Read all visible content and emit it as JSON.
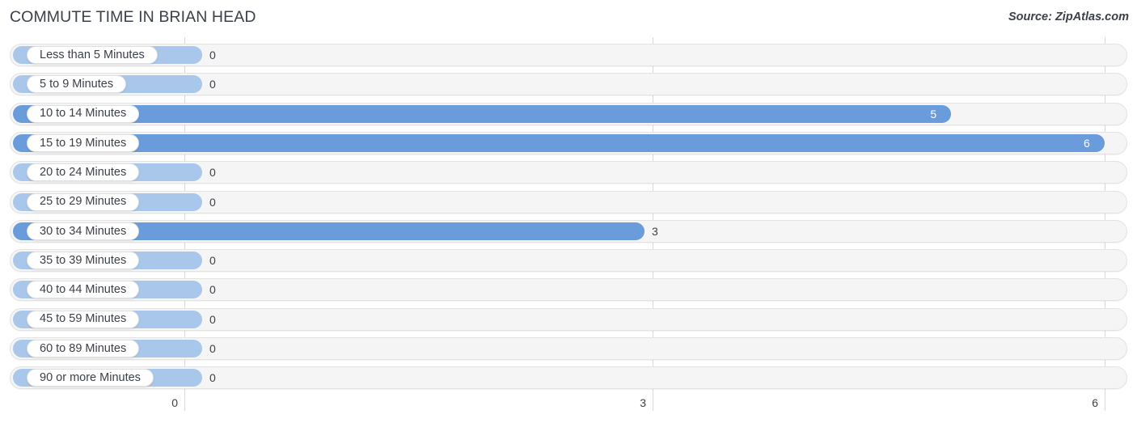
{
  "header": {
    "title": "COMMUTE TIME IN BRIAN HEAD",
    "source": "Source: ZipAtlas.com"
  },
  "colors": {
    "bar_positive": "#6a9bdb",
    "bar_zero": "#a9c7ea",
    "track": "#f5f5f5",
    "gridline": "#d9d9d9",
    "text": "#3c4049"
  },
  "chart_data": {
    "type": "bar",
    "orientation": "horizontal",
    "title": "COMMUTE TIME IN BRIAN HEAD",
    "xlabel": "",
    "ylabel": "",
    "xlim": [
      0,
      6
    ],
    "xticks": [
      "0",
      "3",
      "6"
    ],
    "xtick_values": [
      0,
      3,
      6
    ],
    "grid": true,
    "legend": false,
    "source": "Source: ZipAtlas.com",
    "categories": [
      "Less than 5 Minutes",
      "5 to 9 Minutes",
      "10 to 14 Minutes",
      "15 to 19 Minutes",
      "20 to 24 Minutes",
      "25 to 29 Minutes",
      "30 to 34 Minutes",
      "35 to 39 Minutes",
      "40 to 44 Minutes",
      "45 to 59 Minutes",
      "60 to 89 Minutes",
      "90 or more Minutes"
    ],
    "values": [
      0,
      0,
      5,
      6,
      0,
      0,
      3,
      0,
      0,
      0,
      0,
      0
    ],
    "value_labels": [
      "0",
      "0",
      "5",
      "6",
      "0",
      "0",
      "3",
      "0",
      "0",
      "0",
      "0",
      "0"
    ]
  }
}
